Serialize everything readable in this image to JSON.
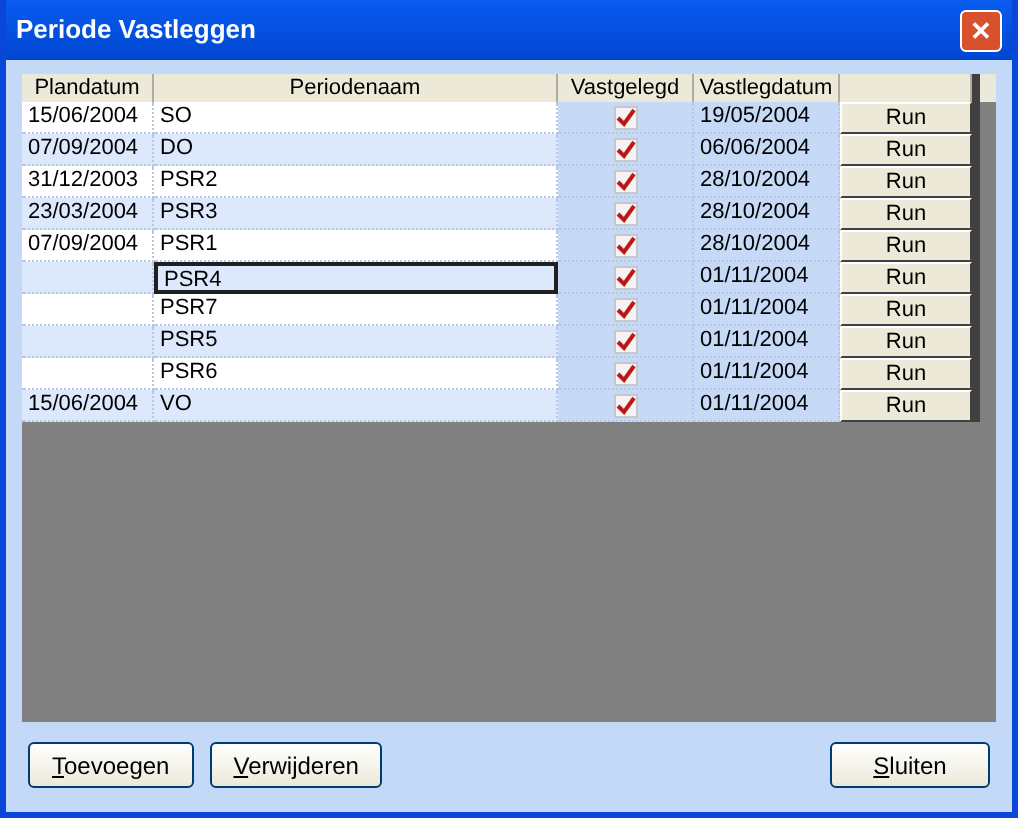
{
  "window": {
    "title": "Periode Vastleggen",
    "close": "✕"
  },
  "table": {
    "columns": [
      "Plandatum",
      "Periodenaam",
      "Vastgelegd",
      "Vastlegdatum"
    ],
    "rows": [
      {
        "plandatum": "15/06/2004",
        "periodenaam": "SO",
        "vastgelegd": true,
        "vastlegdatum": "19/05/2004",
        "action": "Run",
        "focused": false
      },
      {
        "plandatum": "07/09/2004",
        "periodenaam": "DO",
        "vastgelegd": true,
        "vastlegdatum": "06/06/2004",
        "action": "Run",
        "focused": false
      },
      {
        "plandatum": "31/12/2003",
        "periodenaam": "PSR2",
        "vastgelegd": true,
        "vastlegdatum": "28/10/2004",
        "action": "Run",
        "focused": false
      },
      {
        "plandatum": "23/03/2004",
        "periodenaam": "PSR3",
        "vastgelegd": true,
        "vastlegdatum": "28/10/2004",
        "action": "Run",
        "focused": false
      },
      {
        "plandatum": "07/09/2004",
        "periodenaam": "PSR1",
        "vastgelegd": true,
        "vastlegdatum": "28/10/2004",
        "action": "Run",
        "focused": false
      },
      {
        "periodenaam": "PSR4",
        "vastgelegd": true,
        "vastlegdatum": "01/11/2004",
        "action": "Run",
        "focused": true
      },
      {
        "periodenaam": "PSR7",
        "vastgelegd": true,
        "vastlegdatum": "01/11/2004",
        "action": "Run",
        "focused": false
      },
      {
        "periodenaam": "PSR5",
        "vastgelegd": true,
        "vastlegdatum": "01/11/2004",
        "action": "Run",
        "focused": false
      },
      {
        "periodenaam": "PSR6",
        "vastgelegd": true,
        "vastlegdatum": "01/11/2004",
        "action": "Run",
        "focused": false
      },
      {
        "plandatum": "15/06/2004",
        "periodenaam": "VO",
        "vastgelegd": true,
        "vastlegdatum": "01/11/2004",
        "action": "Run",
        "focused": false
      }
    ]
  },
  "buttons": [
    "Toevoegen",
    "Verwijderen",
    "Sluiten"
  ]
}
